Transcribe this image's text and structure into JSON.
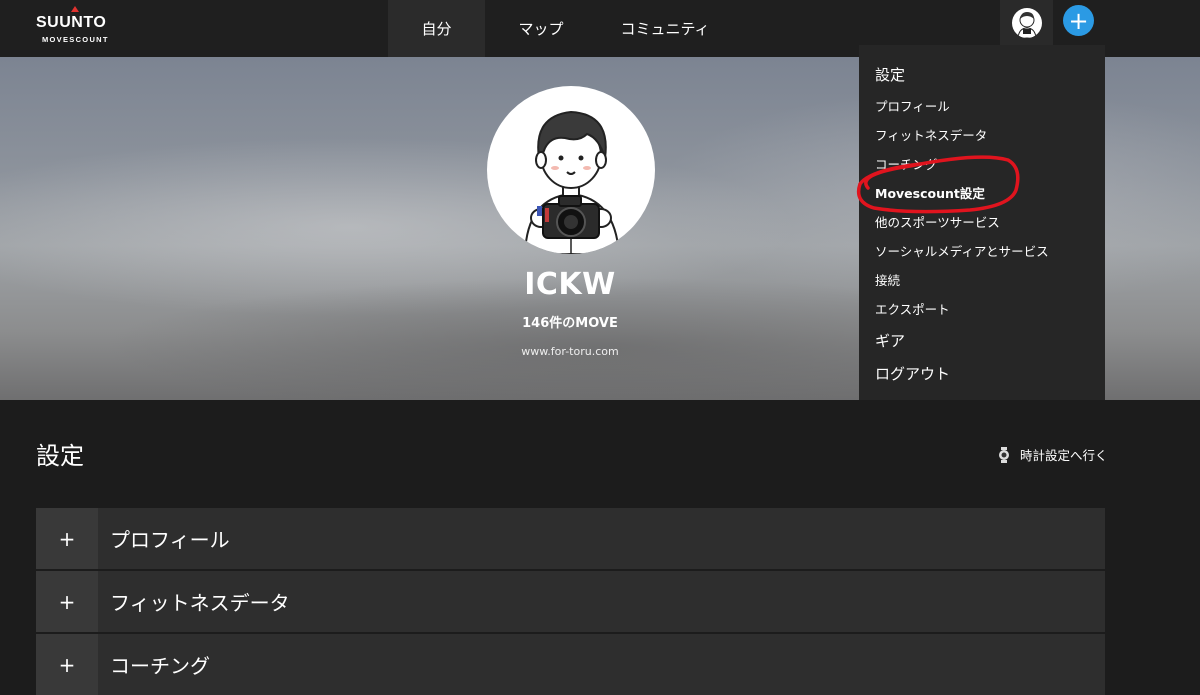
{
  "header": {
    "logo": {
      "brand": "SUUNTO",
      "sub": "MOVESCOUNT"
    },
    "nav": [
      {
        "label": "自分",
        "active": true
      },
      {
        "label": "マップ",
        "active": false
      },
      {
        "label": "コミュニティ",
        "active": false
      }
    ],
    "plus_icon": "plus-icon",
    "plus_glyph": "+",
    "accent_color": "#2b9ae4"
  },
  "profile": {
    "username": "ICKW",
    "move_count": "146件のMOVE",
    "website": "www.for-toru.com"
  },
  "dropdown": {
    "items": [
      {
        "label": "設定"
      },
      {
        "label": "プロフィール"
      },
      {
        "label": "フィットネスデータ"
      },
      {
        "label": "コーチング"
      },
      {
        "label": "Movescount設定",
        "highlighted": true
      },
      {
        "label": "他のスポーツサービス"
      },
      {
        "label": "ソーシャルメディアとサービス"
      },
      {
        "label": "接続"
      },
      {
        "label": "エクスポート"
      },
      {
        "label": "ギア"
      },
      {
        "label": "ログアウト"
      }
    ],
    "annotation_color": "#e0141e"
  },
  "settings": {
    "title": "設定",
    "watch_link": "時計設定へ行く",
    "sections": [
      {
        "expand": "+",
        "label": "プロフィール"
      },
      {
        "expand": "+",
        "label": "フィットネスデータ"
      },
      {
        "expand": "+",
        "label": "コーチング"
      }
    ]
  }
}
